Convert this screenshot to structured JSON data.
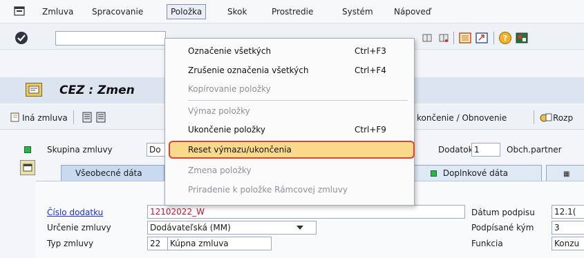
{
  "menubar": {
    "items": [
      "Zmluva",
      "Spracovanie",
      "Položka",
      "Skok",
      "Prostredie",
      "Systém",
      "Nápoveď"
    ]
  },
  "title": "CEZ : Zmen",
  "apptoolbar": {
    "other_contract": "Iná zmluva",
    "termination": "končenie / Obnovenie",
    "rozp": "Rozp"
  },
  "header": {
    "group_label": "Skupina zmluvy",
    "group_value": "Do",
    "addendum_label": "Dodatok",
    "addendum_value": "1",
    "partner_label": "Obch.partner"
  },
  "tabs": {
    "general": "Všeobecné dáta",
    "additional": "Doplnkové dáta"
  },
  "form": {
    "addendum_no_label": "Číslo dodatku",
    "addendum_no_value": "12102022_W",
    "contract_type_label": "Určenie zmluvy",
    "contract_type_value": "Dodávateľská (MM)",
    "type_label": "Typ zmluvy",
    "type_code": "22",
    "type_value": "Kúpna zmluva",
    "sign_date_label": "Dátum podpisu",
    "sign_date_value": "12.1(",
    "signed_by_label": "Podpísané kým",
    "signed_by_value": "3",
    "function_label": "Funkcia",
    "function_value": "Konzu"
  },
  "dropdown": {
    "items": [
      {
        "label": "Označenie všetkých",
        "shortcut": "Ctrl+F3",
        "disabled": false
      },
      {
        "label": "Zrušenie označenia všetkých",
        "shortcut": "Ctrl+F4",
        "disabled": false
      },
      {
        "label": "Kopírovanie položky",
        "shortcut": "",
        "disabled": true
      },
      {
        "label": "Výmaz položky",
        "shortcut": "",
        "disabled": true
      },
      {
        "label": "Ukončenie položky",
        "shortcut": "Ctrl+F9",
        "disabled": false
      },
      {
        "label": "Reset výmazu/ukončenia",
        "shortcut": "",
        "disabled": false
      },
      {
        "label": "Zmena položky",
        "shortcut": "",
        "disabled": true
      },
      {
        "label": "Priradenie k položke Rámcovej zmluvy",
        "shortcut": "",
        "disabled": true
      }
    ]
  },
  "colors": {
    "highlight_border": "#e3402e",
    "highlight_fill": "#fbd98a",
    "link_red": "#c8102e"
  }
}
